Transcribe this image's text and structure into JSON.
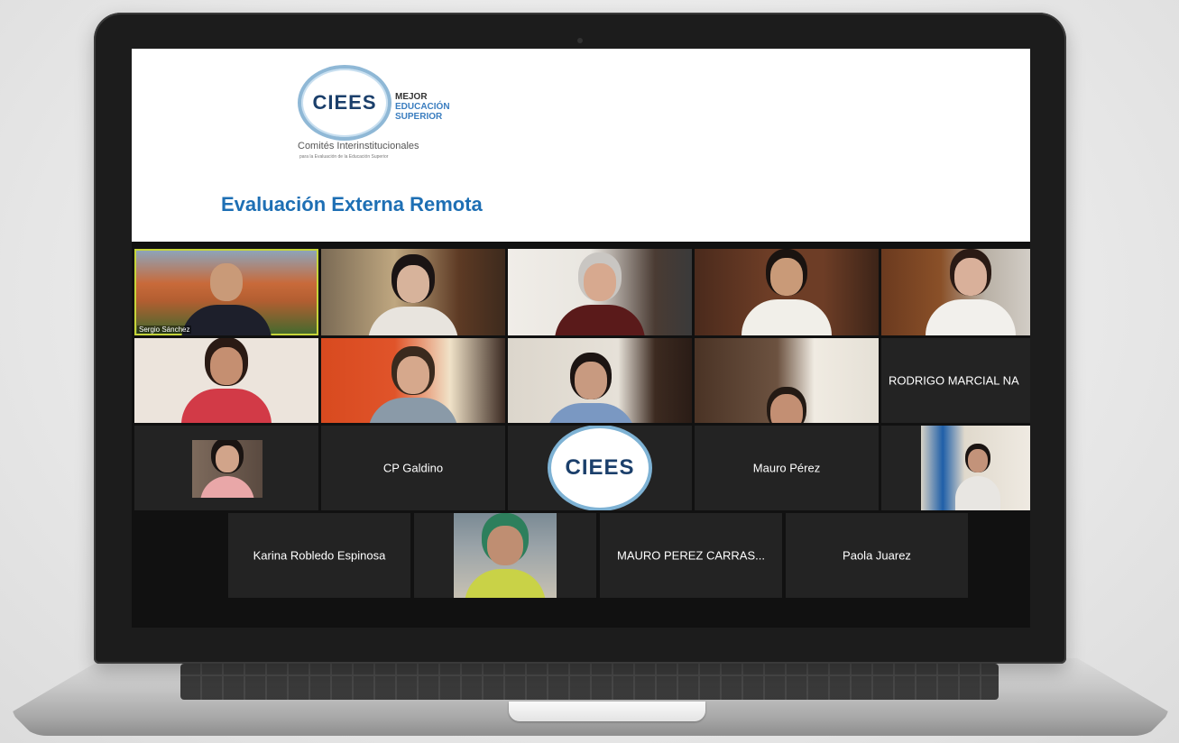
{
  "slide": {
    "logo_text": "CIEES",
    "tagline": [
      "MEJOR",
      "EDUCACIÓN",
      "SUPERIOR"
    ],
    "subtitle": "Comités Interinstitucionales",
    "subtitle_small": "para la Evaluación de la Educación Superior",
    "title": "Evaluación Externa Remota"
  },
  "participants": [
    {
      "label": "Sergio Sánchez"
    },
    {
      "label": "RODRIGO MARCIAL NA"
    },
    {
      "label": "CP Galdino"
    },
    {
      "label": "CIEES"
    },
    {
      "label": "Mauro Pérez"
    },
    {
      "label": "Karina Robledo Espinosa"
    },
    {
      "label": "MAURO PEREZ CARRAS..."
    },
    {
      "label": "Paola Juarez"
    }
  ],
  "colors": {
    "accent": "#1e6fb4",
    "active_speaker": "#c6d43a",
    "tile_bg": "#232323"
  }
}
